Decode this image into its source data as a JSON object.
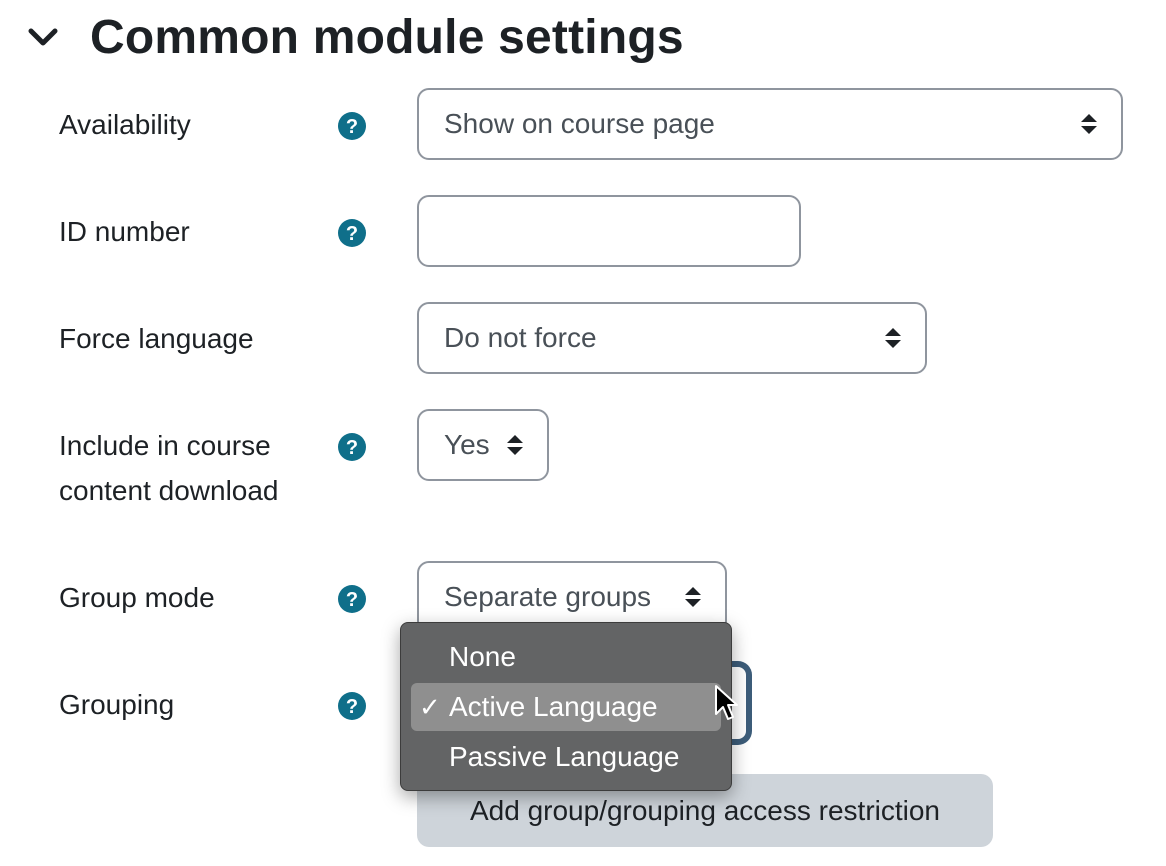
{
  "section": {
    "title": "Common module settings",
    "chevron_icon": "chevron-down-icon"
  },
  "fields": {
    "availability": {
      "label": "Availability",
      "value": "Show on course page"
    },
    "id_number": {
      "label": "ID number",
      "value": ""
    },
    "force_language": {
      "label": "Force language",
      "value": "Do not force"
    },
    "course_download": {
      "label_line1": "Include in course",
      "label_line2": "content download",
      "value": "Yes"
    },
    "group_mode": {
      "label": "Group mode",
      "value": "Separate groups"
    },
    "grouping": {
      "label": "Grouping"
    }
  },
  "dropdown": {
    "options": [
      {
        "label": "None",
        "selected": false
      },
      {
        "label": "Active Language",
        "selected": true
      },
      {
        "label": "Passive Language",
        "selected": false
      }
    ],
    "check_glyph": "✓"
  },
  "buttons": {
    "restriction": "Add group/grouping access restriction"
  },
  "colors": {
    "help_icon": "#0f6f8a",
    "dropdown_bg": "#636465",
    "dropdown_selected": "#8f8f8f",
    "button_bg": "#ced4da",
    "focus_ring": "#3d5d7a"
  }
}
